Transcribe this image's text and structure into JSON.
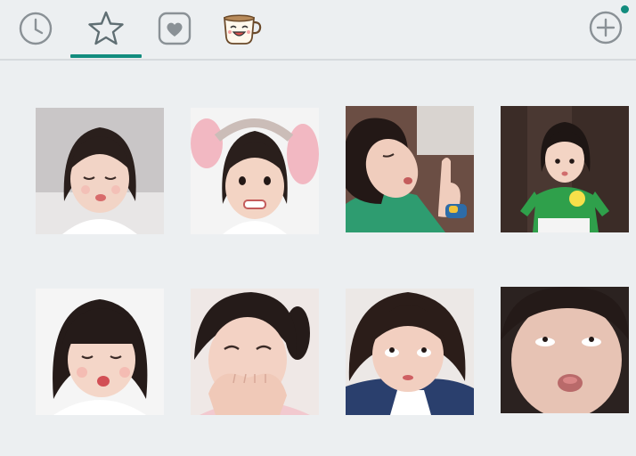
{
  "tabs": [
    {
      "name": "recent",
      "icon": "clock-icon",
      "active": false
    },
    {
      "name": "favorites",
      "icon": "star-icon",
      "active": true
    },
    {
      "name": "liked",
      "icon": "heart-icon",
      "active": false
    },
    {
      "name": "coffee-pack",
      "icon": "coffee-cup-icon",
      "active": false
    }
  ],
  "add_button": {
    "icon": "plus-icon"
  },
  "notification_dot": {
    "color": "#128c7e"
  },
  "accent_color": "#128c7e",
  "stickers": [
    {
      "name": "sticker-girl-eyes-closed-pout",
      "bg": "#c9c6c7",
      "shirt": "#ffffff"
    },
    {
      "name": "sticker-girl-elephant-headband",
      "bg": "#f4f4f4",
      "shirt": "#ffffff",
      "ears": "#f2b8c2"
    },
    {
      "name": "sticker-girl-thumbs-up",
      "bg": "#6b4e44",
      "shirt": "#2e9c70"
    },
    {
      "name": "sticker-girl-green-shirt",
      "bg": "#3b2c27",
      "shirt": "#2fa04b"
    },
    {
      "name": "sticker-girl-kissy-face",
      "bg": "#f5f5f5",
      "shirt": "#ffffff"
    },
    {
      "name": "sticker-girl-laughing-hands",
      "bg": "#efe8e6",
      "shirt": "#f2c9cf"
    },
    {
      "name": "sticker-girl-rolling-eyes",
      "bg": "#ece8e6",
      "shirt": "#2a3f6d"
    },
    {
      "name": "sticker-girl-closeup-pout",
      "bg": "#2b2220",
      "shirt": "#e7c3b4"
    }
  ]
}
